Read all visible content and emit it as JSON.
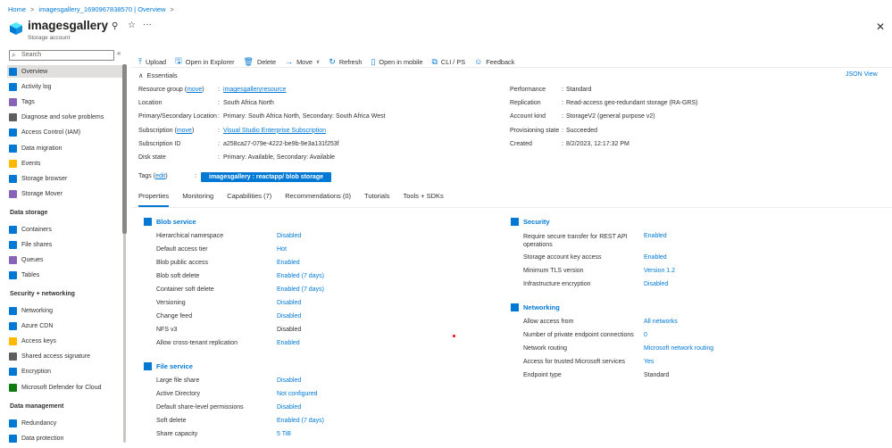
{
  "breadcrumb": {
    "home": "Home",
    "sep": ">",
    "resource": "imagesgallery_1690967838570 | Overview"
  },
  "header": {
    "title": "imagesgallery",
    "subtitle": "Storage account",
    "pin_glyph": "⚲",
    "star_glyph": "☆",
    "more_glyph": "···",
    "close_glyph": "✕"
  },
  "sidebar": {
    "search_placeholder": "Search",
    "search_glyph": "⌕",
    "collapse_glyph": "«",
    "items": [
      {
        "label": "Overview",
        "icon": "overview-icon",
        "color": "#0078d4",
        "active": true
      },
      {
        "label": "Activity log",
        "icon": "activity-log-icon",
        "color": "#0078d4"
      },
      {
        "label": "Tags",
        "icon": "tags-icon",
        "color": "#8764b8"
      },
      {
        "label": "Diagnose and solve problems",
        "icon": "wrench-icon",
        "color": "#605e5c"
      },
      {
        "label": "Access Control (IAM)",
        "icon": "iam-icon",
        "color": "#0078d4"
      },
      {
        "label": "Data migration",
        "icon": "data-migration-icon",
        "color": "#0078d4"
      },
      {
        "label": "Events",
        "icon": "events-icon",
        "color": "#ffb900"
      },
      {
        "label": "Storage browser",
        "icon": "storage-browser-icon",
        "color": "#0078d4"
      },
      {
        "label": "Storage Mover",
        "icon": "storage-mover-icon",
        "color": "#8764b8"
      }
    ],
    "sections": [
      {
        "title": "Data storage",
        "items": [
          {
            "label": "Containers",
            "icon": "containers-icon",
            "color": "#0078d4"
          },
          {
            "label": "File shares",
            "icon": "file-shares-icon",
            "color": "#0078d4"
          },
          {
            "label": "Queues",
            "icon": "queues-icon",
            "color": "#8764b8"
          },
          {
            "label": "Tables",
            "icon": "tables-icon",
            "color": "#0078d4"
          }
        ]
      },
      {
        "title": "Security + networking",
        "items": [
          {
            "label": "Networking",
            "icon": "networking-icon",
            "color": "#0078d4"
          },
          {
            "label": "Azure CDN",
            "icon": "cdn-icon",
            "color": "#0078d4"
          },
          {
            "label": "Access keys",
            "icon": "key-icon",
            "color": "#ffb900"
          },
          {
            "label": "Shared access signature",
            "icon": "link-icon",
            "color": "#605e5c"
          },
          {
            "label": "Encryption",
            "icon": "encryption-icon",
            "color": "#0078d4"
          },
          {
            "label": "Microsoft Defender for Cloud",
            "icon": "defender-icon",
            "color": "#107c10"
          }
        ]
      },
      {
        "title": "Data management",
        "items": [
          {
            "label": "Redundancy",
            "icon": "redundancy-icon",
            "color": "#0078d4"
          },
          {
            "label": "Data protection",
            "icon": "data-protection-icon",
            "color": "#0078d4"
          }
        ]
      }
    ]
  },
  "toolbar": {
    "upload": "Upload",
    "open_explorer": "Open in Explorer",
    "delete": "Delete",
    "move": "Move",
    "refresh": "Refresh",
    "open_mobile": "Open in mobile",
    "cli_ps": "CLI / PS",
    "feedback": "Feedback",
    "move_chevron": "∨"
  },
  "essentials": {
    "toggle_glyph": "∧",
    "title": "Essentials",
    "json_view": "JSON View",
    "left": [
      {
        "label": "Resource group",
        "label_link": "move",
        "value": "imagesgalleryresource",
        "value_link": true
      },
      {
        "label": "Location",
        "value": "South Africa North"
      },
      {
        "label": "Primary/Secondary Location",
        "value": "Primary: South Africa North, Secondary: South Africa West"
      },
      {
        "label": "Subscription",
        "label_link": "move",
        "value": "Visual Studio Enterprise Subscription",
        "value_link": true
      },
      {
        "label": "Subscription ID",
        "value": "a258ca27-079e-4222-be9b-9e3a131f253f"
      },
      {
        "label": "Disk state",
        "value": "Primary: Available, Secondary: Available"
      }
    ],
    "right": [
      {
        "label": "Performance",
        "value": "Standard"
      },
      {
        "label": "Replication",
        "value": "Read-access geo-redundant storage (RA-GRS)"
      },
      {
        "label": "Account kind",
        "value": "StorageV2 (general purpose v2)"
      },
      {
        "label": "Provisioning state",
        "value": "Succeeded"
      },
      {
        "label": "Created",
        "value": "8/2/2023, 12:17:32 PM"
      }
    ],
    "tags": {
      "label": "Tags",
      "edit": "edit",
      "value": "imagesgallery : reactapp/ blob storage"
    }
  },
  "tabs": [
    "Properties",
    "Monitoring",
    "Capabilities (7)",
    "Recommendations (0)",
    "Tutorials",
    "Tools + SDKs"
  ],
  "properties": {
    "blob_service": {
      "title": "Blob service",
      "rows": [
        {
          "label": "Hierarchical namespace",
          "value": "Disabled",
          "link": true
        },
        {
          "label": "Default access tier",
          "value": "Hot",
          "link": true
        },
        {
          "label": "Blob public access",
          "value": "Enabled",
          "link": true
        },
        {
          "label": "Blob soft delete",
          "value": "Enabled (7 days)",
          "link": true
        },
        {
          "label": "Container soft delete",
          "value": "Enabled (7 days)",
          "link": true
        },
        {
          "label": "Versioning",
          "value": "Disabled",
          "link": true
        },
        {
          "label": "Change feed",
          "value": "Disabled",
          "link": true
        },
        {
          "label": "NFS v3",
          "value": "Disabled",
          "link": false
        },
        {
          "label": "Allow cross-tenant replication",
          "value": "Enabled",
          "link": true
        }
      ]
    },
    "file_service": {
      "title": "File service",
      "rows": [
        {
          "label": "Large file share",
          "value": "Disabled",
          "link": true
        },
        {
          "label": "Active Directory",
          "value": "Not configured",
          "link": true
        },
        {
          "label": "Default share-level permissions",
          "value": "Disabled",
          "link": true
        },
        {
          "label": "Soft delete",
          "value": "Enabled (7 days)",
          "link": true
        },
        {
          "label": "Share capacity",
          "value": "5 TiB",
          "link": true
        }
      ]
    },
    "security": {
      "title": "Security",
      "rows": [
        {
          "label": "Require secure transfer for REST API operations",
          "value": "Enabled",
          "link": true
        },
        {
          "label": "Storage account key access",
          "value": "Enabled",
          "link": true
        },
        {
          "label": "Minimum TLS version",
          "value": "Version 1.2",
          "link": true
        },
        {
          "label": "Infrastructure encryption",
          "value": "Disabled",
          "link": true
        }
      ]
    },
    "networking": {
      "title": "Networking",
      "rows": [
        {
          "label": "Allow access from",
          "value": "All networks",
          "link": true
        },
        {
          "label": "Number of private endpoint connections",
          "value": "0",
          "link": true
        },
        {
          "label": "Network routing",
          "value": "Microsoft network routing",
          "link": true
        },
        {
          "label": "Access for trusted Microsoft services",
          "value": "Yes",
          "link": true
        },
        {
          "label": "Endpoint type",
          "value": "Standard",
          "link": false
        }
      ]
    }
  }
}
